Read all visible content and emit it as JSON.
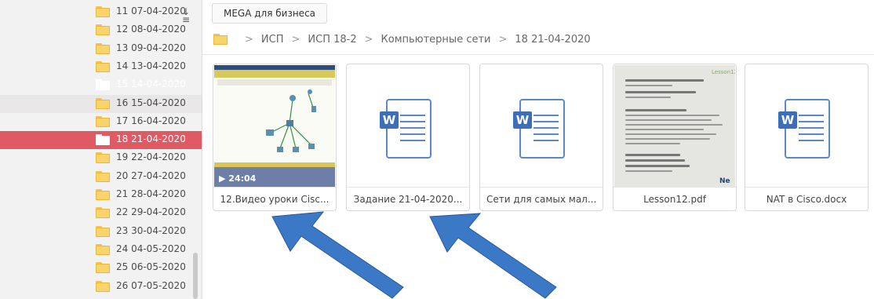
{
  "sidebar": {
    "folders": [
      {
        "label": "11 07-04-2020",
        "state": "normal"
      },
      {
        "label": "12 08-04-2020",
        "state": "normal"
      },
      {
        "label": "13 09-04-2020",
        "state": "normal"
      },
      {
        "label": "14 13-04-2020",
        "state": "normal"
      },
      {
        "label": "15 14-04-2020",
        "state": "faded"
      },
      {
        "label": "16 15-04-2020",
        "state": "hover"
      },
      {
        "label": "17 16-04-2020",
        "state": "normal"
      },
      {
        "label": "18 21-04-2020",
        "state": "selected"
      },
      {
        "label": "19 22-04-2020",
        "state": "normal"
      },
      {
        "label": "20 27-04-2020",
        "state": "normal"
      },
      {
        "label": "21 28-04-2020",
        "state": "normal"
      },
      {
        "label": "22 29-04-2020",
        "state": "normal"
      },
      {
        "label": "23 30-04-2020",
        "state": "normal"
      },
      {
        "label": "24 04-05-2020",
        "state": "normal"
      },
      {
        "label": "25 06-05-2020",
        "state": "normal"
      },
      {
        "label": "26 07-05-2020",
        "state": "normal"
      }
    ],
    "sort_icon": "sort-descending-icon"
  },
  "header": {
    "business_button": "MEGA для бизнеса"
  },
  "breadcrumb": {
    "items": [
      "ИСП",
      "ИСП 18-2",
      "Компьютерные сети",
      "18 21-04-2020"
    ],
    "separator": ">"
  },
  "files": [
    {
      "name": "12.Видео уроки Cisc...",
      "type": "video",
      "duration": "24:04"
    },
    {
      "name": "Задание 21-04-2020...",
      "type": "word"
    },
    {
      "name": "Сети для самых мал...",
      "type": "word"
    },
    {
      "name": "Lesson12.pdf",
      "type": "pdf"
    },
    {
      "name": "NAT в Cisco.docx",
      "type": "word"
    }
  ],
  "pdf_preview": {
    "tag": "Lesson12",
    "logo": "Ne"
  },
  "colors": {
    "accent": "#e05a63",
    "folder": "#f9d46a",
    "word": "#3c6fb8",
    "arrow": "#3b78c6"
  }
}
